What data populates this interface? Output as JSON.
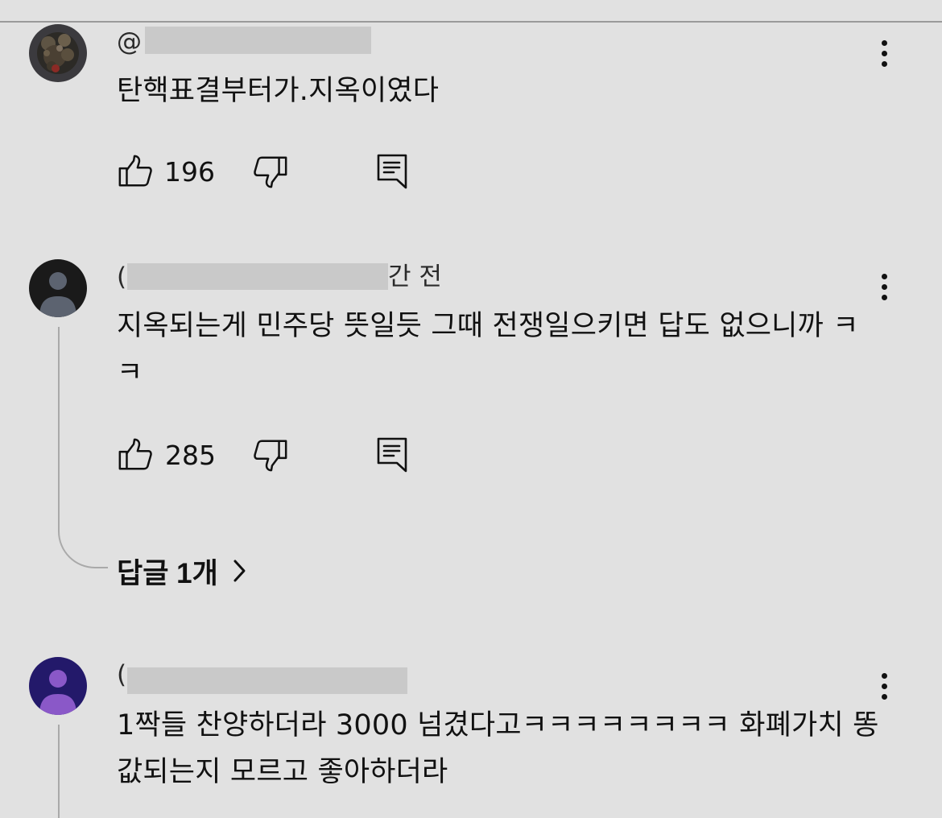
{
  "comments": [
    {
      "handle": "@",
      "text": "탄핵표결부터가.지옥이였다",
      "likes": "196"
    },
    {
      "handle": "(",
      "handle_tail": "간 전",
      "text": "지옥되는게 민주당 뜻일듯 그때 전쟁일으키면 답도 없으니까 ㅋㅋ",
      "likes": "285",
      "replies_label": "답글 1개"
    },
    {
      "handle": "(",
      "text": "1짝들 찬양하더라 3000 넘겼다고ㅋㅋㅋㅋㅋㅋㅋㅋ 화폐가치 똥값되는지 모르고 좋아하더라"
    }
  ],
  "icons": {
    "like": "thumb-up-icon",
    "dislike": "thumb-down-icon",
    "reply": "reply-comment-icon",
    "more": "more-vertical-icon",
    "chevron": "chevron-right-icon"
  },
  "colors": {
    "background": "#e1e1e1",
    "text": "#111111",
    "redaction": "#c9c9c9",
    "avatar_default": "#1a1a1a",
    "avatar_purple": "#23196a"
  }
}
